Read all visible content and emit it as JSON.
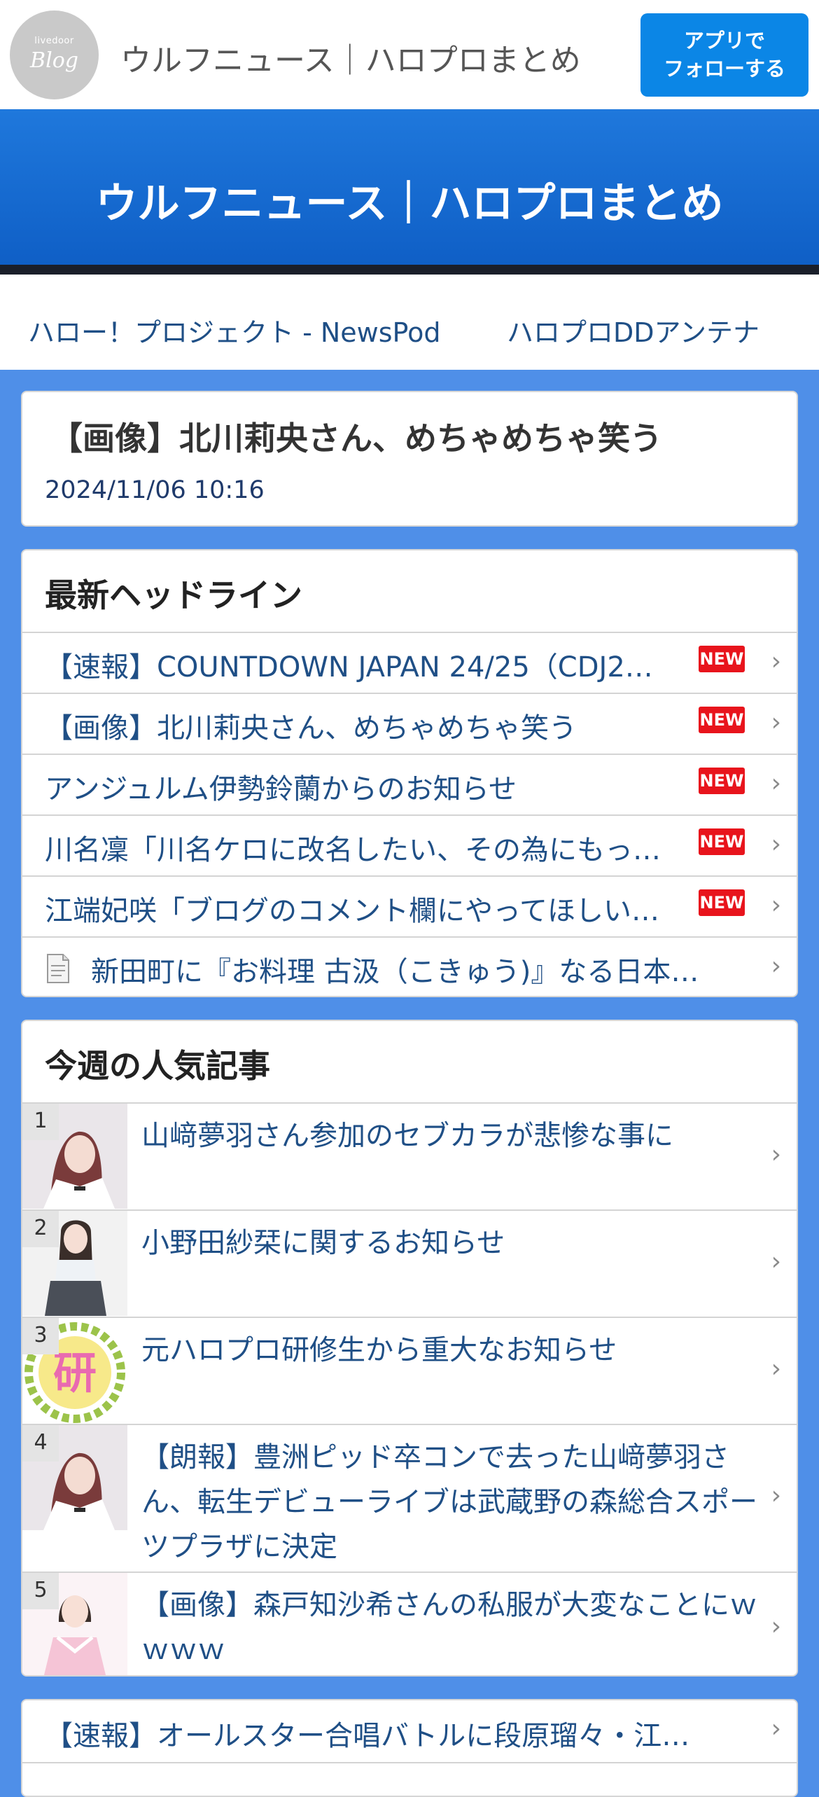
{
  "header": {
    "logo_small": "livedoor",
    "logo_big": "Blog",
    "site_name": "ウルフニュース｜ハロプロまとめ",
    "follow_line1": "アプリで",
    "follow_line2": "フォローする"
  },
  "hero": {
    "title": "ウルフニュース｜ハロプロまとめ"
  },
  "links": [
    "ハロー！プロジェクト - NewsPod",
    "ハロプロDDアンテナ"
  ],
  "article": {
    "title": "【画像】北川莉央さん、めちゃめちゃ笑う",
    "date": "2024/11/06 10:16"
  },
  "headlines": {
    "title": "最新ヘッドライン",
    "new_label": "NEW",
    "items": [
      {
        "text": "【速報】COUNTDOWN JAPAN 24/25（CDJ2…",
        "new": true
      },
      {
        "text": "【画像】北川莉央さん、めちゃめちゃ笑う",
        "new": true
      },
      {
        "text": "アンジュルム伊勢鈴蘭からのお知らせ",
        "new": true
      },
      {
        "text": "川名凜「川名ケロに改名したい、その為にもっ…",
        "new": true
      },
      {
        "text": "江端妃咲「ブログのコメント欄にやってほしい…",
        "new": true
      },
      {
        "text": "新田町に『お料理 古汲（こきゅう)』なる日本…",
        "new": false
      }
    ]
  },
  "popular": {
    "title": "今週の人気記事",
    "items": [
      {
        "rank": "1",
        "text": "山﨑夢羽さん参加のセブカラが悲惨な事に"
      },
      {
        "rank": "2",
        "text": "小野田紗栞に関するお知らせ"
      },
      {
        "rank": "3",
        "text": "元ハロプロ研修生から重大なお知らせ",
        "thumb_text": "研"
      },
      {
        "rank": "4",
        "text": "【朗報】豊洲ピッド卒コンで去った山﨑夢羽さん、転生デビューライブは武蔵野の森総合スポーツプラザに決定"
      },
      {
        "rank": "5",
        "text": "【画像】森戸知沙希さんの私服が大変なことにｗｗｗｗ"
      }
    ]
  },
  "bottom": {
    "item": "【速報】オールスター合唱バトルに段原瑠々・江…"
  },
  "colors": {
    "page_bg": "#4f8fe8",
    "accent": "#0b86e6",
    "link": "#1f4f86",
    "new_badge": "#e8141c"
  }
}
